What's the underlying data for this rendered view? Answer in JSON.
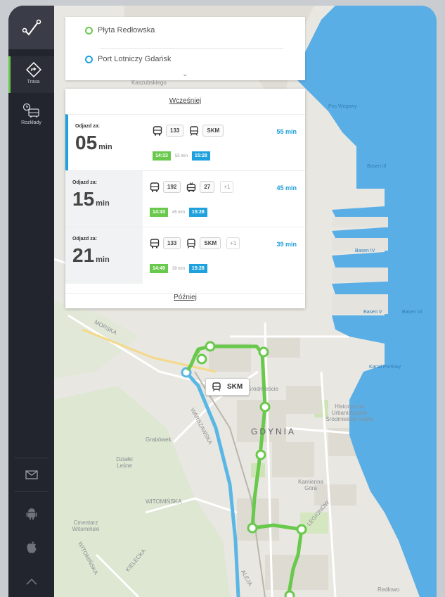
{
  "sidebar": {
    "items": [
      {
        "label": "Trasa",
        "icon": "route-icon"
      },
      {
        "label": "Rozkłady",
        "icon": "schedule-icon"
      }
    ],
    "bottom_icons": [
      "mail-icon",
      "android-icon",
      "apple-icon",
      "chevron-up-icon"
    ]
  },
  "search": {
    "from": "Płyta Redłowska",
    "to": "Port Lotniczy Gdańsk"
  },
  "results": {
    "earlier_label": "Wcześniej",
    "later_label": "Później",
    "routes": [
      {
        "depart_label": "Odjazd za:",
        "minutes": "05",
        "unit": "min",
        "vehicles": [
          {
            "type": "bus",
            "line": "133"
          },
          {
            "type": "train",
            "line": "SKM"
          }
        ],
        "extra": "",
        "duration": "55 min",
        "dep_time": "14:33",
        "mid": "55 min",
        "arr_time": "15:28"
      },
      {
        "depart_label": "Odjazd za:",
        "minutes": "15",
        "unit": "min",
        "vehicles": [
          {
            "type": "bus",
            "line": "192"
          },
          {
            "type": "trolley",
            "line": "27"
          }
        ],
        "extra": "+1",
        "duration": "45 min",
        "dep_time": "14:43",
        "mid": "45 min",
        "arr_time": "15:28"
      },
      {
        "depart_label": "Odjazd za:",
        "minutes": "21",
        "unit": "min",
        "vehicles": [
          {
            "type": "bus",
            "line": "133"
          },
          {
            "type": "train",
            "line": "SKM"
          }
        ],
        "extra": "+1",
        "duration": "39 min",
        "dep_time": "14:49",
        "mid": "39 min",
        "arr_time": "15:28"
      }
    ]
  },
  "map": {
    "city": "GDYNIA",
    "skm_tag": "SKM",
    "labels": {
      "kasz": "Kaszubskiego",
      "pirs": "Pirs Wegowy",
      "bas3": "Basen III",
      "bas4": "Basen IV",
      "bas5": "Basen V",
      "bas6": "Basen VI",
      "katew": "Kanał Portowy",
      "morska": "MORSKA",
      "wart": "WARSZAWSKA",
      "grabowek": "Grabówek",
      "dzialki": "Działki Leśne",
      "cmentarz": "Cmentarz Witomiński",
      "witom": "WITOMIŃSKA",
      "hist": "Historyczne Urbanistyczne Śródmieście Gdyni",
      "kamienna": "Kamienna Góra",
      "legionow": "LEGIONÓW",
      "kielecka": "KIELECKA",
      "witom2": "WITOMIŃSKA",
      "srodmiescie": "Śródmieście",
      "redlowo": "Redłowo",
      "aleja": "ALEJA"
    }
  },
  "colors": {
    "accent_green": "#69c94c",
    "accent_blue": "#1ea1dc",
    "sea": "#5aaee6",
    "sidebar": "#23252e"
  }
}
